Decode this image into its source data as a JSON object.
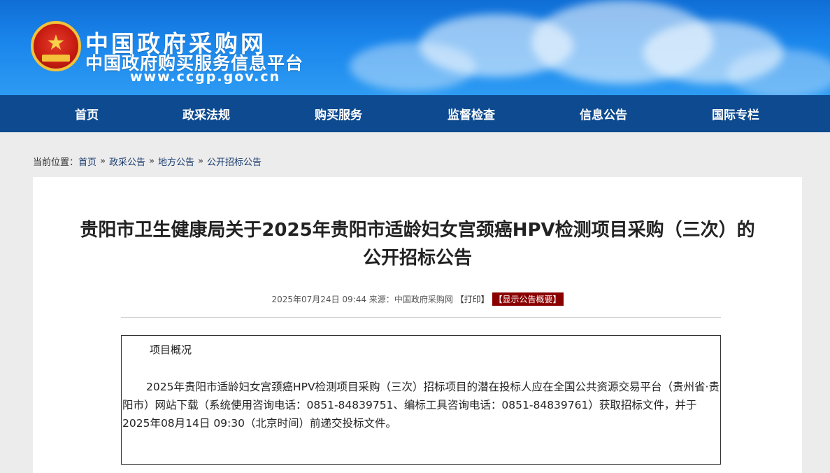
{
  "site": {
    "title": "中国政府采购网",
    "subtitle": "中国政府购买服务信息平台",
    "url": "www.ccgp.gov.cn"
  },
  "nav": {
    "items": [
      {
        "label": "首页"
      },
      {
        "label": "政采法规"
      },
      {
        "label": "购买服务"
      },
      {
        "label": "监督检查"
      },
      {
        "label": "信息公告"
      },
      {
        "label": "国际专栏"
      }
    ]
  },
  "breadcrumb": {
    "prefix": "当前位置：",
    "items": [
      "首页",
      "政采公告",
      "地方公告",
      "公开招标公告"
    ],
    "separator": "»"
  },
  "article": {
    "title_line1": "贵阳市卫生健康局关于2025年贵阳市适龄妇女宫颈癌HPV检测项目采购（三次）的",
    "title_line2": "公开招标公告",
    "datetime": "2025年07月24日 09:44",
    "source_label": "来源：",
    "source": "中国政府采购网",
    "print_label": "【打印】",
    "summary_button": "【显示公告概要】",
    "overview_heading": "项目概况",
    "overview_text": "2025年贵阳市适龄妇女宫颈癌HPV检测项目采购（三次）招标项目的潜在投标人应在全国公共资源交易平台（贵州省·贵阳市）网站下载（系统使用咨询电话：0851-84839751、编标工具咨询电话：0851-84839761）获取招标文件，并于2025年08月14日 09:30（北京时间）前递交投标文件。"
  },
  "colors": {
    "banner": "#1a86ec",
    "nav": "#0d4a8f",
    "summary_button": "#8a0000"
  }
}
